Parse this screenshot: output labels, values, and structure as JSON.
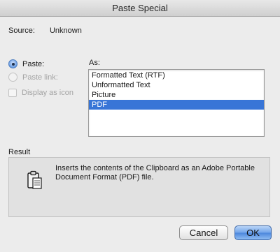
{
  "window": {
    "title": "Paste Special"
  },
  "source": {
    "label": "Source:",
    "value": "Unknown"
  },
  "options": {
    "paste_label": "Paste:",
    "paste_link_label": "Paste link:",
    "display_as_icon_label": "Display as icon"
  },
  "as": {
    "label": "As:",
    "items": [
      "Formatted Text (RTF)",
      "Unformatted Text",
      "Picture",
      "PDF"
    ],
    "selected": "PDF"
  },
  "result": {
    "label": "Result",
    "text": "Inserts the contents of the Clipboard as an Adobe Portable Document Format (PDF) file."
  },
  "buttons": {
    "cancel": "Cancel",
    "ok": "OK"
  },
  "icons": {
    "result_icon": "clipboard-icon"
  }
}
